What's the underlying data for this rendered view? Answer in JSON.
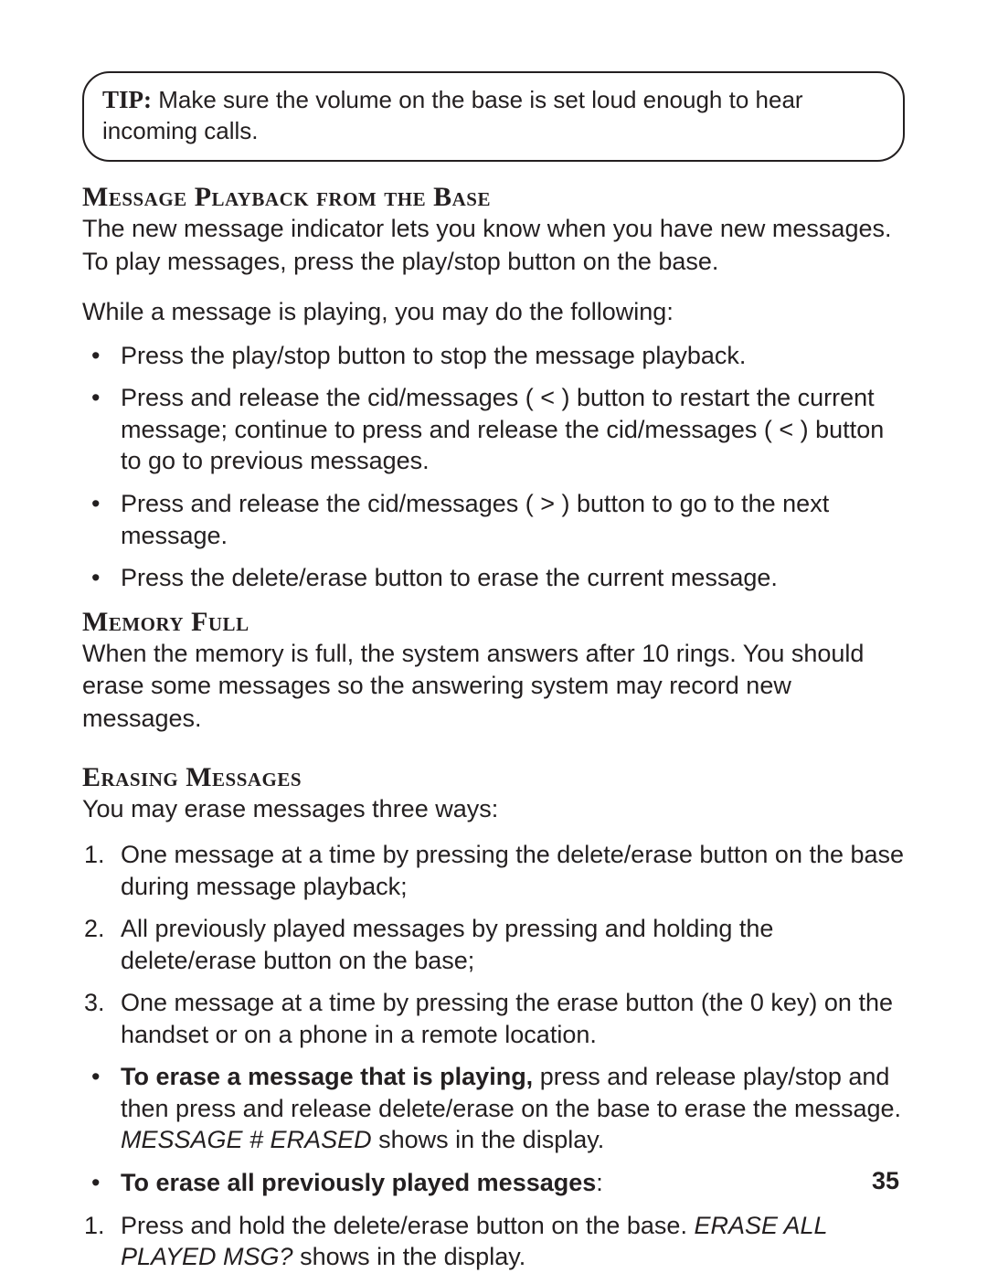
{
  "tip": {
    "label": "TIP:",
    "text": " Make sure the volume on the base is set loud enough to hear incoming calls."
  },
  "section1": {
    "heading": "Message Playback from the Base",
    "p1": "The new message indicator lets you know when you have new messages. To play messages, press the play/stop button on the base.",
    "p2": "While a message is playing, you may do the following:",
    "bullets": [
      "Press the play/stop button to stop the message playback.",
      "Press and release the cid/messages ( < ) button to restart the current message; continue to press and release the cid/messages ( < ) button to go to previous messages.",
      "Press and release the cid/messages ( > ) button to go to the next message.",
      "Press the delete/erase button to erase the current message."
    ]
  },
  "section2": {
    "heading": "Memory Full",
    "p1": "When the memory is full, the system answers after 10 rings. You should erase some messages so the answering system may record new messages."
  },
  "section3": {
    "heading": "Erasing Messages",
    "p1": "You may erase messages three ways:",
    "numbers": [
      "One message at a time by pressing the delete/erase button on the base during message playback;",
      "All previously played messages by pressing and holding the delete/erase button on the base;",
      "One message at a time by pressing the erase button (the 0 key) on the handset or on a phone in a remote location."
    ],
    "b1_bold": "To erase a message that is playing,",
    "b1_rest": " press and release play/stop and then press and release delete/erase on the base to erase the message. ",
    "b1_italic": "MESSAGE # ERASED",
    "b1_tail": " shows in the display.",
    "b2_bold": "To erase all previously played messages",
    "b2_tail": ":",
    "n4_a": "Press and hold the delete/erase button on the base. ",
    "n4_italic": "ERASE ALL PLAYED MSG?",
    "n4_b": " shows in the display."
  },
  "page_number": "35"
}
